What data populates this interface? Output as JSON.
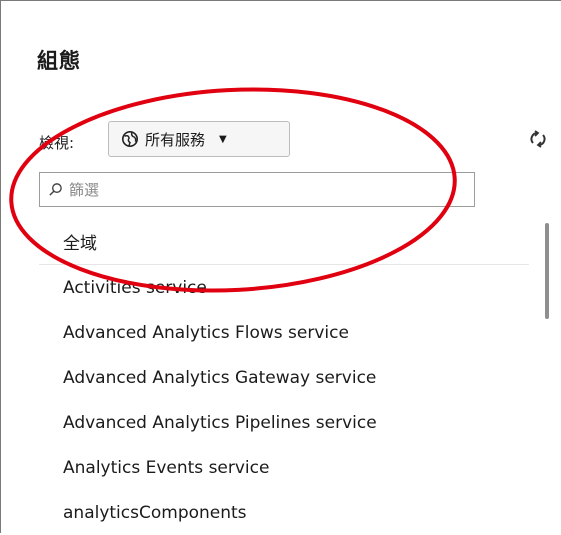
{
  "panel": {
    "title": "組態",
    "view_label": "檢視:",
    "view_select": {
      "value": "所有服務",
      "icon": "globe-icon"
    },
    "refresh_icon": "refresh-icon",
    "filter": {
      "placeholder": "篩選",
      "value": "",
      "icon": "search-icon"
    },
    "items": [
      {
        "label": "全域"
      },
      {
        "label": "Activities service"
      },
      {
        "label": "Advanced Analytics Flows service"
      },
      {
        "label": "Advanced Analytics Gateway service"
      },
      {
        "label": "Advanced Analytics Pipelines service"
      },
      {
        "label": "Analytics Events service"
      },
      {
        "label": "analyticsComponents"
      }
    ]
  },
  "annotation": {
    "shape": "ellipse",
    "color": "#e0000f"
  }
}
